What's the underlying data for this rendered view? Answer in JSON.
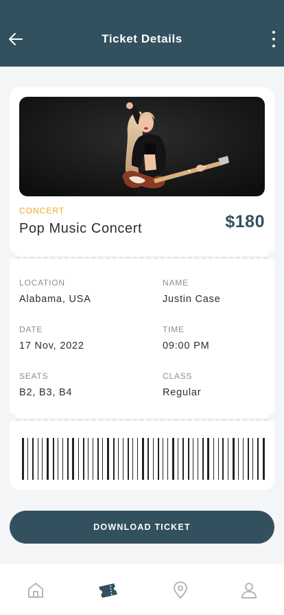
{
  "header": {
    "title": "Ticket Details",
    "back_icon": "arrow-left-icon",
    "menu_icon": "more-vertical-icon"
  },
  "event": {
    "category": "CONCERT",
    "name": "Pop Music Concert",
    "price": "$180",
    "image": "concert-performer-with-guitar-photo"
  },
  "details": [
    {
      "label": "LOCATION",
      "value": "Alabama, USA"
    },
    {
      "label": "NAME",
      "value": "Justin Case"
    },
    {
      "label": "DATE",
      "value": "17 Nov, 2022"
    },
    {
      "label": "TIME",
      "value": "09:00 PM"
    },
    {
      "label": "SEATS",
      "value": "B2, B3, B4"
    },
    {
      "label": "CLASS",
      "value": "Regular"
    }
  ],
  "actions": {
    "download_label": "DOWNLOAD TICKET"
  },
  "tabbar": {
    "items": [
      {
        "icon": "home-icon",
        "active": false
      },
      {
        "icon": "ticket-icon",
        "active": true
      },
      {
        "icon": "location-pin-icon",
        "active": false
      },
      {
        "icon": "user-icon",
        "active": false
      }
    ]
  },
  "colors": {
    "primary": "#33505e",
    "accent": "#f0a818",
    "background": "#f4f5f6",
    "inactive_icon": "#b3b6bb"
  }
}
